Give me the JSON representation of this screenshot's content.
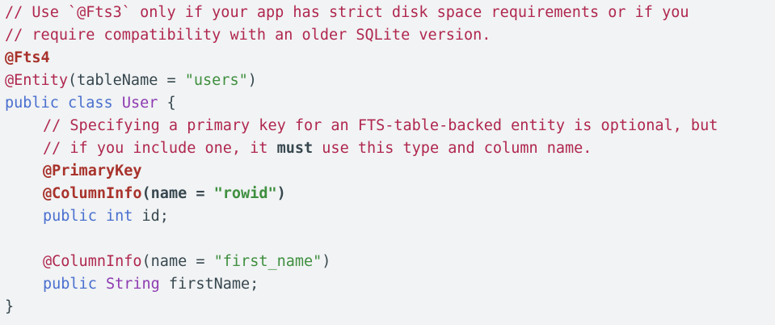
{
  "code": {
    "line1": "// Use `@Fts3` only if your app has strict disk space requirements or if you",
    "line2": "// require compatibility with an older SQLite version.",
    "line3_ann": "@Fts4",
    "line4_ann": "@Entity",
    "line4_open": "(tableName = ",
    "line4_str": "\"users\"",
    "line4_close": ")",
    "line5_kw1": "public",
    "line5_kw2": "class",
    "line5_type": "User",
    "line5_rest": " {",
    "line6": "// Specifying a primary key for an FTS-table-backed entity is optional, but",
    "line7_a": "// if you include one, it ",
    "line7_b": "must",
    "line7_c": " use this type and column name.",
    "line8_ann": "@PrimaryKey",
    "line9_ann": "@ColumnInfo",
    "line9_open": "(name = ",
    "line9_str": "\"rowid\"",
    "line9_close": ")",
    "line10_kw1": "public",
    "line10_kw2": "int",
    "line10_rest": " id;",
    "line12_ann": "@ColumnInfo",
    "line12_open": "(name = ",
    "line12_str": "\"first_name\"",
    "line12_close": ")",
    "line13_kw": "public",
    "line13_type": "String",
    "line13_rest": " firstName;",
    "line14": "}"
  },
  "colors": {
    "background": "#f1f3f4",
    "comment": "#b0274f",
    "keyword": "#4a6fcf",
    "type": "#8e3bb1",
    "string": "#3f8f3f",
    "plain": "#37474f"
  }
}
